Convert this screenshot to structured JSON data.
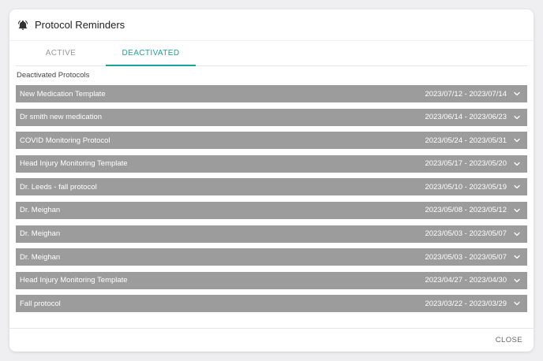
{
  "dialog": {
    "title": "Protocol Reminders",
    "title_icon": "bell-icon"
  },
  "tabs": [
    {
      "label": "ACTIVE",
      "selected": false
    },
    {
      "label": "DEACTIVATED",
      "selected": true
    }
  ],
  "section_label": "Deactivated Protocols",
  "protocols": [
    {
      "name": "New Medication Template",
      "dates": "2023/07/12 - 2023/07/14"
    },
    {
      "name": "Dr smith new medication",
      "dates": "2023/06/14 - 2023/06/23"
    },
    {
      "name": "COVID Monitoring Protocol",
      "dates": "2023/05/24 - 2023/05/31"
    },
    {
      "name": "Head Injury Monitoring Template",
      "dates": "2023/05/17 - 2023/05/20"
    },
    {
      "name": "Dr. Leeds - fall protocol",
      "dates": "2023/05/10 - 2023/05/19"
    },
    {
      "name": "Dr. Meighan",
      "dates": "2023/05/08 - 2023/05/12"
    },
    {
      "name": "Dr. Meighan",
      "dates": "2023/05/03 - 2023/05/07"
    },
    {
      "name": "Dr. Meighan",
      "dates": "2023/05/03 - 2023/05/07"
    },
    {
      "name": "Head Injury Monitoring Template",
      "dates": "2023/04/27 - 2023/04/30"
    },
    {
      "name": "Fall protocol",
      "dates": "2023/03/22 - 2023/03/29"
    }
  ],
  "footer": {
    "close_label": "CLOSE"
  },
  "colors": {
    "accent": "#1aa39a",
    "row_bg": "#9c9c9c",
    "row_text": "#ffffff"
  }
}
